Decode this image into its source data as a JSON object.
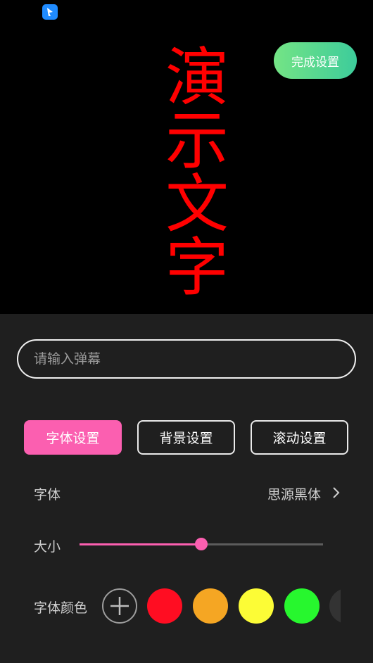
{
  "preview": {
    "text": "演示文字",
    "text_color": "#ff0000",
    "app_icon": "app-launcher-icon",
    "done_button": "完成设置"
  },
  "input": {
    "placeholder": "请输入弹幕",
    "value": ""
  },
  "tabs": [
    {
      "label": "字体设置",
      "active": true
    },
    {
      "label": "背景设置",
      "active": false
    },
    {
      "label": "滚动设置",
      "active": false
    }
  ],
  "font_row": {
    "label": "字体",
    "value": "思源黑体",
    "icon": "chevron-right-icon"
  },
  "size_row": {
    "label": "大小",
    "level": 0.5,
    "accent": "#fb5fb0"
  },
  "color_row": {
    "label": "字体颜色",
    "add_icon": "plus-icon",
    "colors": [
      "#ff0d22",
      "#f5a623",
      "#fcfc36",
      "#27f72e",
      "#333333"
    ]
  }
}
